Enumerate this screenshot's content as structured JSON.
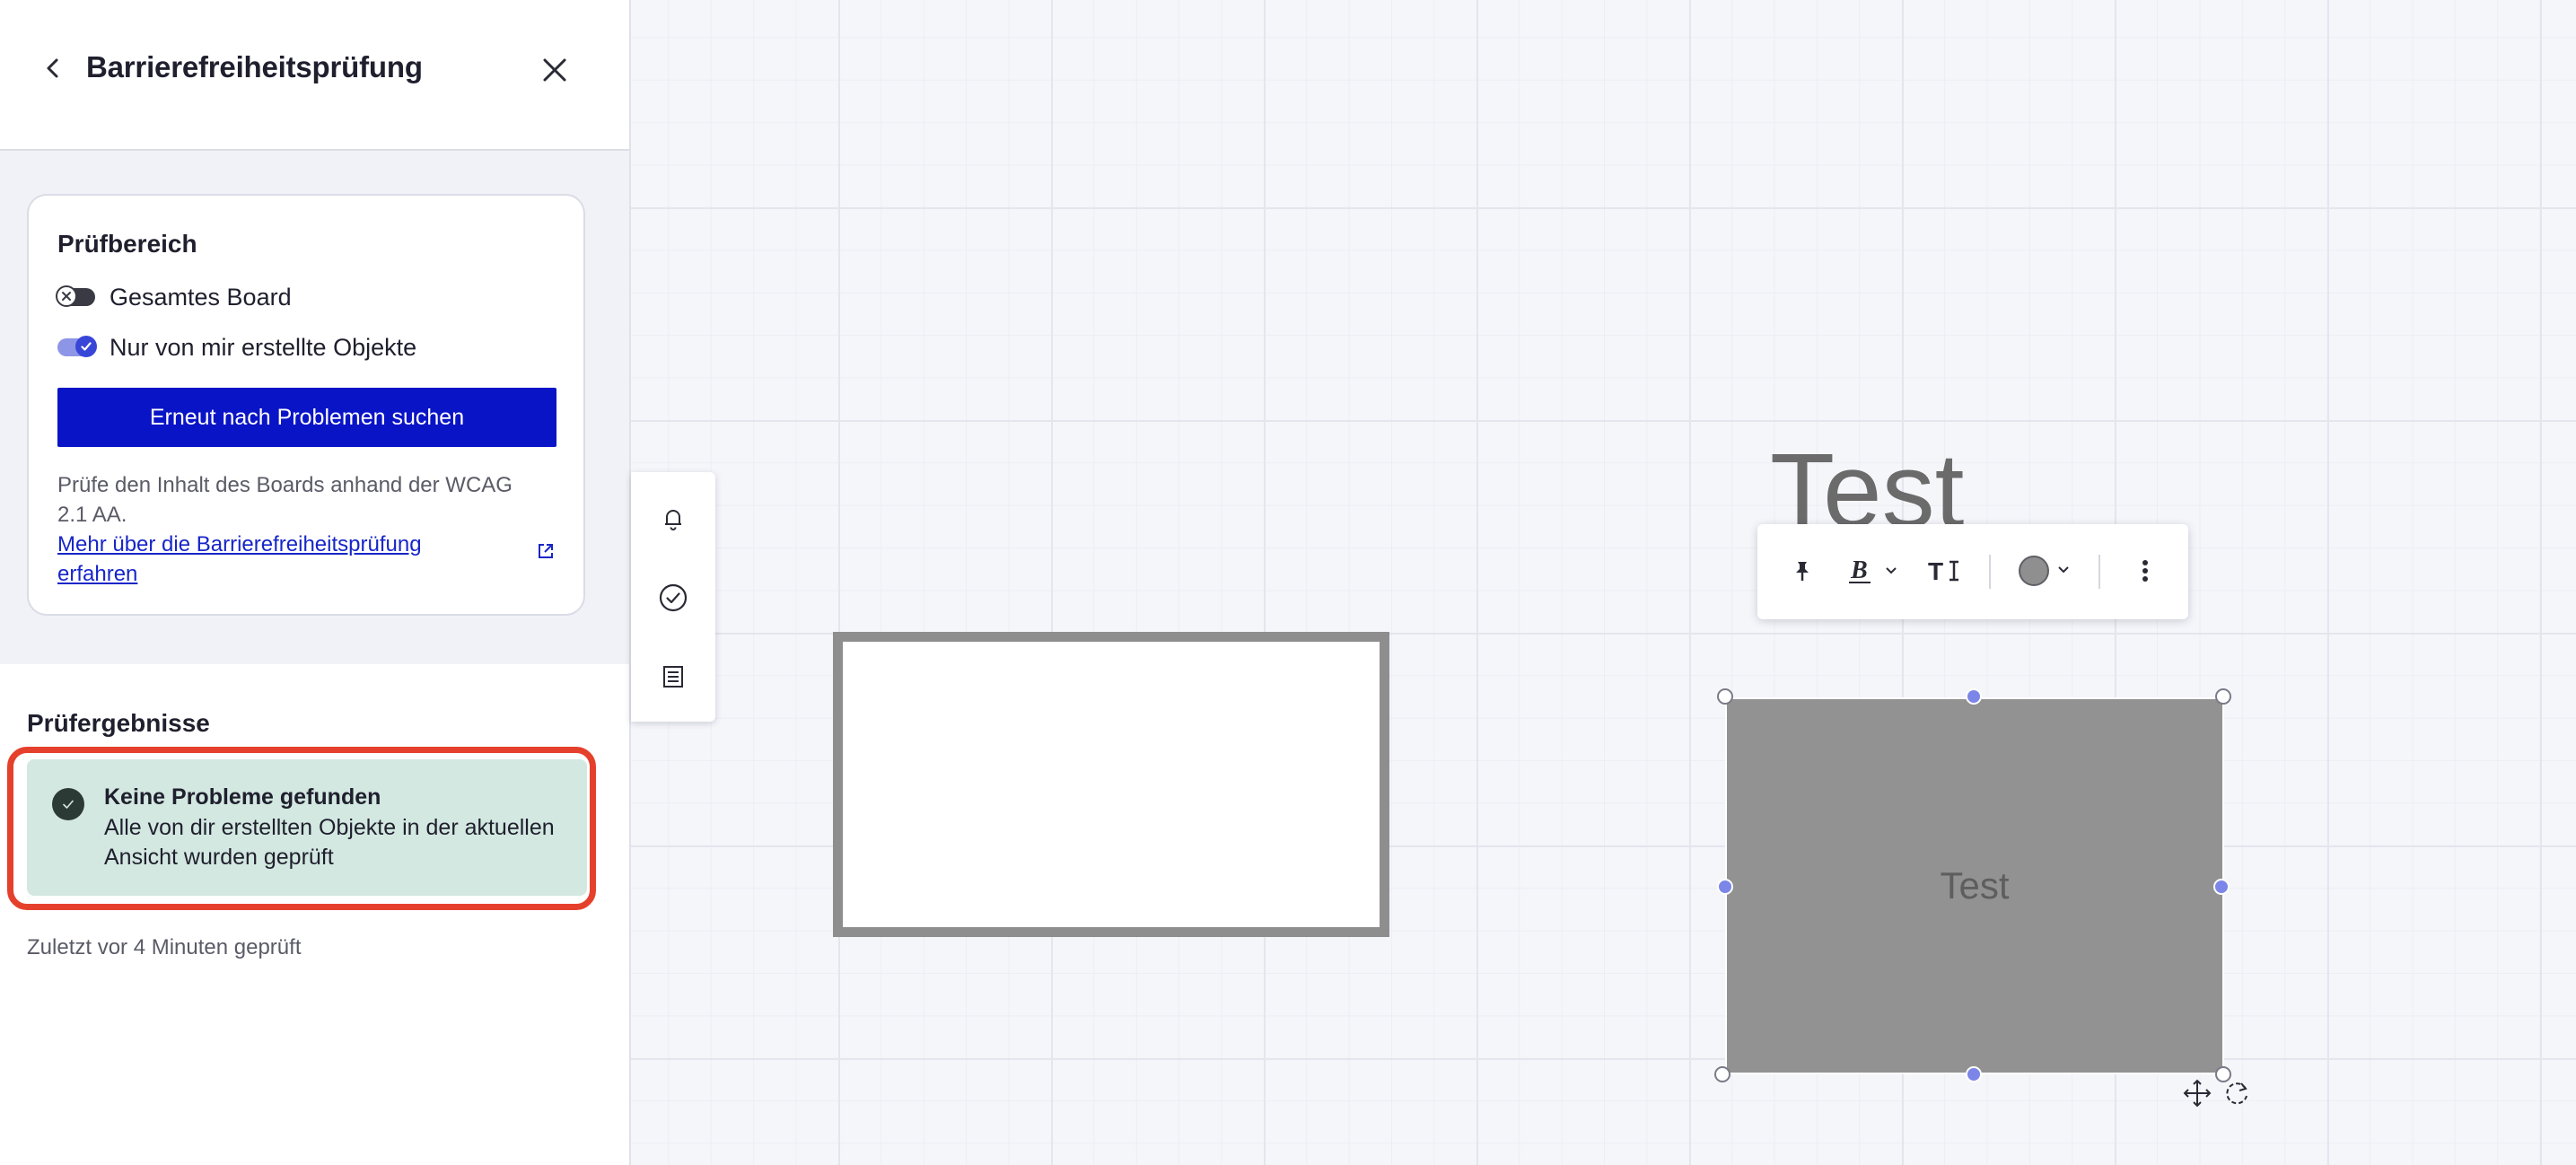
{
  "panel": {
    "title": "Barrierefreiheitsprüfung",
    "back_icon": "chevron-left-icon",
    "close_icon": "close-icon"
  },
  "scope": {
    "title": "Prüfbereich",
    "options": [
      {
        "label": "Gesamtes Board",
        "enabled": false
      },
      {
        "label": "Nur von mir erstellte Objekte",
        "enabled": true
      }
    ],
    "scan_button": "Erneut nach Problemen suchen",
    "description": "Prüfe den Inhalt des Boards anhand der WCAG 2.1 AA.",
    "learn_more": "Mehr über die Barrierefreiheitsprüfung erfahren"
  },
  "results": {
    "title": "Prüfergebnisse",
    "card_title": "Keine Probleme gefunden",
    "card_text": "Alle von dir erstellten Objekte in der aktuellen Ansicht wurden geprüft",
    "last_checked": "Zuletzt vor 4 Minuten geprüft"
  },
  "canvas": {
    "heading_text": "Test",
    "shape_text": "Test",
    "toolbar_icons": [
      "pin-icon",
      "bold-icon",
      "text-size-icon",
      "color-icon",
      "more-icon"
    ],
    "side_icons": [
      "bell-icon",
      "check-circle-icon",
      "list-icon"
    ],
    "colors": {
      "accent": "#0a14c7",
      "success_bg": "#d3e8e0",
      "highlight": "#e5402c",
      "shape_fill": "#929292",
      "frame_border": "#8e8e8e"
    }
  }
}
